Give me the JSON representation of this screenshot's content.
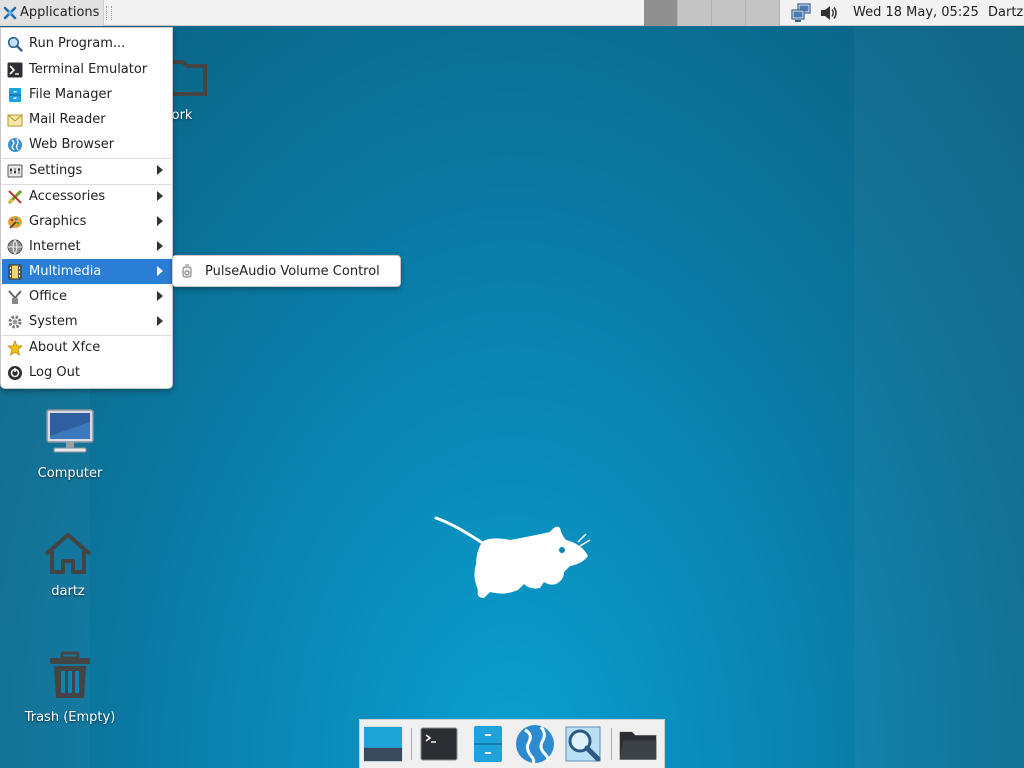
{
  "panel": {
    "apps_label": "Applications",
    "clock": "Wed 18 May, 05:25",
    "user": "Dartz",
    "workspaces": 4,
    "active_workspace": 1
  },
  "desktop": {
    "network_label": "work",
    "computer_label": "Computer",
    "home_label": "dartz",
    "trash_label": "Trash (Empty)"
  },
  "menu": {
    "items": [
      {
        "label": "Run Program...",
        "icon": "search-icon"
      },
      {
        "label": "Terminal Emulator",
        "icon": "terminal-icon"
      },
      {
        "label": "File Manager",
        "icon": "file-manager-icon"
      },
      {
        "label": "Mail Reader",
        "icon": "mail-icon"
      },
      {
        "label": "Web Browser",
        "icon": "globe-icon"
      },
      {
        "label": "Settings",
        "icon": "settings-icon",
        "submenu": true
      },
      {
        "label": "Accessories",
        "icon": "accessories-icon",
        "submenu": true
      },
      {
        "label": "Graphics",
        "icon": "graphics-icon",
        "submenu": true
      },
      {
        "label": "Internet",
        "icon": "internet-icon",
        "submenu": true
      },
      {
        "label": "Multimedia",
        "icon": "multimedia-icon",
        "submenu": true,
        "selected": true
      },
      {
        "label": "Office",
        "icon": "office-icon",
        "submenu": true
      },
      {
        "label": "System",
        "icon": "system-icon",
        "submenu": true
      },
      {
        "label": "About Xfce",
        "icon": "star-icon"
      },
      {
        "label": "Log Out",
        "icon": "logout-icon"
      }
    ]
  },
  "submenu": {
    "items": [
      {
        "label": "PulseAudio Volume Control",
        "icon": "volume-control-icon"
      }
    ]
  },
  "colors": {
    "selection": "#2a7fd4",
    "panel_bg": "#f2f2f2",
    "wallpaper": "#0a86b4"
  }
}
